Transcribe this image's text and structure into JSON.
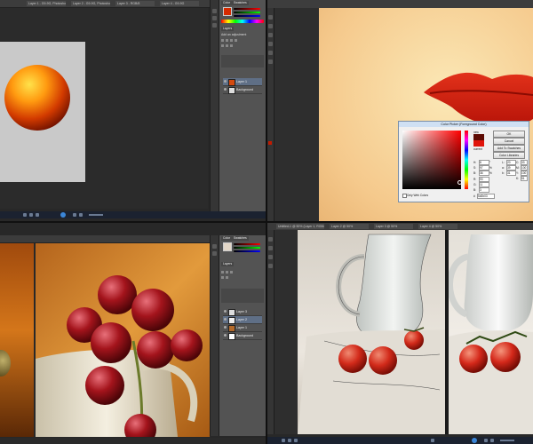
{
  "quad1": {
    "tabs": [
      "Layer 1 - G9-9G, Photoshop - RGB/8",
      "Layer 2 - G9-9G, Photoshop - RGB/8",
      "Layer 3 - RGB/8",
      "Layer 4 - G9-9G"
    ],
    "panel": {
      "tabs": [
        "Color",
        "Swatches",
        "Styles"
      ],
      "layers_title": "Layers",
      "adjust_label": "Add an adjustment",
      "layers": [
        "Layer 1",
        "Background"
      ]
    }
  },
  "quad2": {
    "color_picker": {
      "title": "Color Picker (Foreground Color)",
      "new_label": "new",
      "current_label": "current",
      "buttons": {
        "ok": "OK",
        "cancel": "Cancel",
        "add_swatches": "Add To Swatches",
        "libraries": "Color Libraries"
      },
      "fields": [
        {
          "label": "H:",
          "value": "8",
          "unit": "°"
        },
        {
          "label": "S:",
          "value": "97",
          "unit": "%"
        },
        {
          "label": "B:",
          "value": "36",
          "unit": "%"
        },
        {
          "label": "R:",
          "value": "93",
          "unit": ""
        },
        {
          "label": "G:",
          "value": "11",
          "unit": ""
        },
        {
          "label": "B:",
          "value": "3",
          "unit": ""
        }
      ],
      "lab_fields": [
        {
          "label": "L:",
          "value": "20"
        },
        {
          "label": "a:",
          "value": "39"
        },
        {
          "label": "b:",
          "value": "31"
        }
      ],
      "cmyk_fields": [
        {
          "label": "C:",
          "value": "33",
          "unit": "%"
        },
        {
          "label": "M:",
          "value": "100",
          "unit": "%"
        },
        {
          "label": "Y:",
          "value": "100",
          "unit": "%"
        },
        {
          "label": "K:",
          "value": "51",
          "unit": "%"
        }
      ],
      "hex": "5d0b03",
      "only_web_colors": "Only Web Colors"
    }
  },
  "quad3": {
    "panel": {
      "tabs": [
        "Color",
        "Swatches"
      ],
      "layers_title": "Layers",
      "layers": [
        "Layer 3",
        "Layer 2",
        "Layer 1",
        "Background"
      ]
    }
  },
  "quad4": {
    "tabs": [
      "Untitled-1 @ 50% (Layer 1, RGB/8)",
      "Layer 2 @ 50%",
      "Layer 3 @ 50%",
      "Layer 4 @ 50%"
    ]
  }
}
